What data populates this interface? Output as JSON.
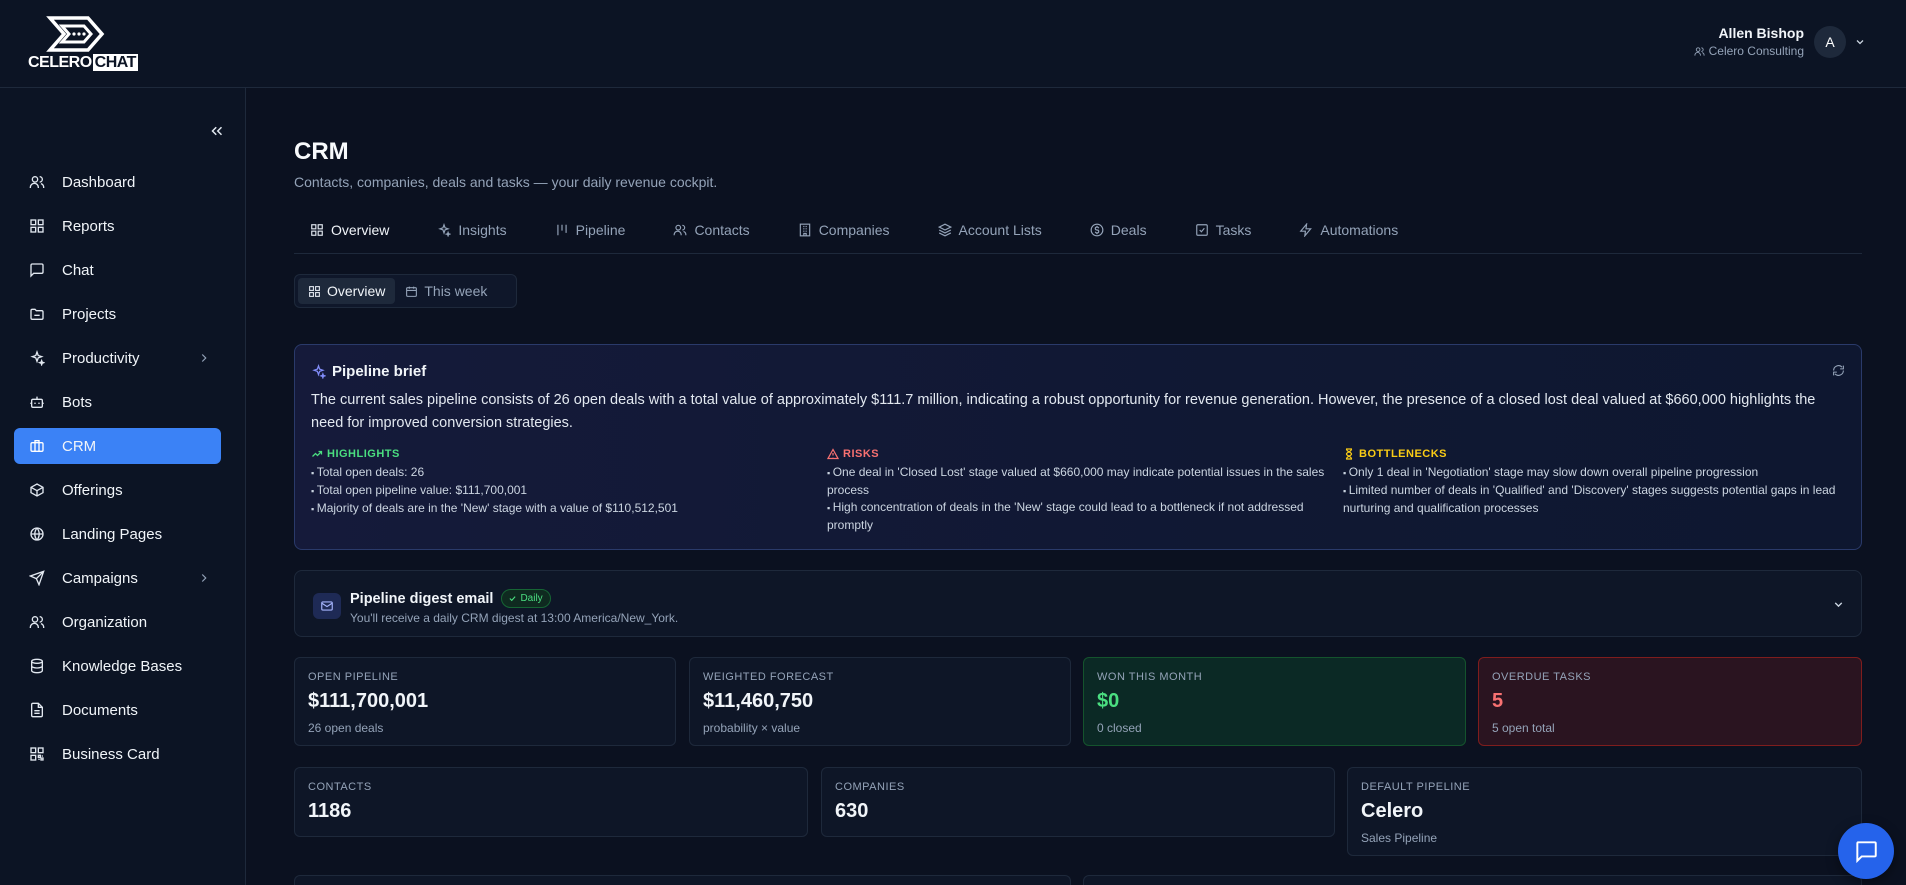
{
  "app": {
    "logo_text": "CELERO",
    "logo_text_box": "CHAT"
  },
  "user": {
    "name": "Allen Bishop",
    "org": "Celero Consulting",
    "initial": "A"
  },
  "sidebar": {
    "items": [
      {
        "label": "Dashboard",
        "icon": "users-icon"
      },
      {
        "label": "Reports",
        "icon": "grid-icon"
      },
      {
        "label": "Chat",
        "icon": "message-icon"
      },
      {
        "label": "Projects",
        "icon": "folder-icon"
      },
      {
        "label": "Productivity",
        "icon": "sparkles-icon",
        "has_submenu": true
      },
      {
        "label": "Bots",
        "icon": "bot-icon"
      },
      {
        "label": "CRM",
        "icon": "briefcase-icon",
        "active": true
      },
      {
        "label": "Offerings",
        "icon": "package-icon"
      },
      {
        "label": "Landing Pages",
        "icon": "globe-icon"
      },
      {
        "label": "Campaigns",
        "icon": "send-icon",
        "has_submenu": true
      },
      {
        "label": "Organization",
        "icon": "users-icon"
      },
      {
        "label": "Knowledge Bases",
        "icon": "database-icon"
      },
      {
        "label": "Documents",
        "icon": "file-icon"
      },
      {
        "label": "Business Card",
        "icon": "qr-icon"
      }
    ]
  },
  "page": {
    "title": "CRM",
    "subtitle": "Contacts, companies, deals and tasks — your daily revenue cockpit."
  },
  "tabs": [
    {
      "label": "Overview",
      "icon": "grid-icon",
      "active": true
    },
    {
      "label": "Insights",
      "icon": "sparkles-icon"
    },
    {
      "label": "Pipeline",
      "icon": "columns-icon"
    },
    {
      "label": "Contacts",
      "icon": "users-icon"
    },
    {
      "label": "Companies",
      "icon": "building-icon"
    },
    {
      "label": "Account Lists",
      "icon": "layers-icon"
    },
    {
      "label": "Deals",
      "icon": "dollar-icon"
    },
    {
      "label": "Tasks",
      "icon": "checkbox-icon"
    },
    {
      "label": "Automations",
      "icon": "zap-icon"
    }
  ],
  "subtabs": [
    {
      "label": "Overview",
      "icon": "grid-icon",
      "active": true
    },
    {
      "label": "This week",
      "icon": "calendar-icon"
    }
  ],
  "brief": {
    "title": "Pipeline brief",
    "text": "The current sales pipeline consists of 26 open deals with a total value of approximately $111.7 million, indicating a robust opportunity for revenue generation. However, the presence of a closed lost deal valued at $660,000 highlights the need for improved conversion strategies.",
    "highlights": {
      "title": "HIGHLIGHTS",
      "color": "#4ade80",
      "items": [
        "Total open deals: 26",
        "Total open pipeline value: $111,700,001",
        "Majority of deals are in the 'New' stage with a value of $110,512,501"
      ]
    },
    "risks": {
      "title": "RISKS",
      "color": "#f87171",
      "items": [
        "One deal in 'Closed Lost' stage valued at $660,000 may indicate potential issues in the sales process",
        "High concentration of deals in the 'New' stage could lead to a bottleneck if not addressed promptly"
      ]
    },
    "bottlenecks": {
      "title": "BOTTLENECKS",
      "color": "#facc15",
      "items": [
        "Only 1 deal in 'Negotiation' stage may slow down overall pipeline progression",
        "Limited number of deals in 'Qualified' and 'Discovery' stages suggests potential gaps in lead nurturing and qualification processes"
      ]
    }
  },
  "digest": {
    "title": "Pipeline digest email",
    "badge": "Daily",
    "subtitle": "You'll receive a daily CRM digest at 13:00 America/New_York."
  },
  "stats": {
    "open_pipeline": {
      "label": "OPEN PIPELINE",
      "value": "$111,700,001",
      "caption": "26 open deals"
    },
    "weighted_forecast": {
      "label": "WEIGHTED FORECAST",
      "value": "$11,460,750",
      "caption": "probability × value"
    },
    "won_this_month": {
      "label": "WON THIS MONTH",
      "value": "$0",
      "caption": "0 closed"
    },
    "overdue_tasks": {
      "label": "OVERDUE TASKS",
      "value": "5",
      "caption": "5 open total"
    },
    "contacts": {
      "label": "CONTACTS",
      "value": "1186"
    },
    "companies": {
      "label": "COMPANIES",
      "value": "630"
    },
    "default_pipeline": {
      "label": "DEFAULT PIPELINE",
      "value": "Celero",
      "caption": "Sales Pipeline"
    }
  },
  "colors": {
    "accent": "#3b82f6",
    "background": "#0b1120",
    "success": "#4ade80",
    "danger": "#f87171",
    "warning": "#facc15"
  }
}
